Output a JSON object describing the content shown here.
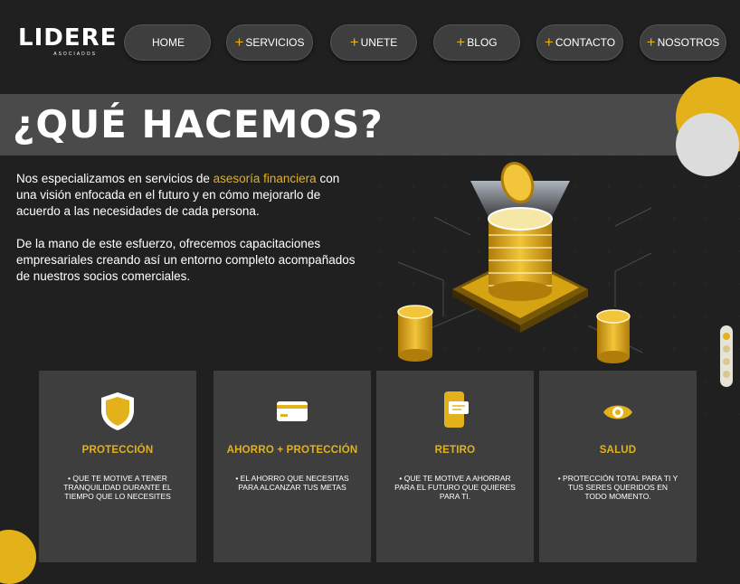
{
  "brand": {
    "name": "LIDERE",
    "tagline": "ASOCIADOS"
  },
  "nav": [
    {
      "label": "HOME",
      "plus": ""
    },
    {
      "label": "SERVICIOS",
      "plus": "+"
    },
    {
      "label": "UNETE",
      "plus": "+"
    },
    {
      "label": "BLOG",
      "plus": "+"
    },
    {
      "label": "CONTACTO",
      "plus": "+"
    },
    {
      "label": "NOSOTROS",
      "plus": "+"
    }
  ],
  "banner": {
    "title": "¿QUÉ HACEMOS?"
  },
  "intro": {
    "p1_before": "Nos especializamos en servicios de ",
    "p1_highlight": "asesoría financiera",
    "p1_after": " con una visión enfocada en el futuro y en cómo mejorarlo de acuerdo a las necesidades de cada persona.",
    "p2": "De la mano de este esfuerzo, ofrecemos capacitaciones empresariales creando así un entorno completo acompañados de nuestros socios comerciales."
  },
  "cards": [
    {
      "title": "PROTECCIÓN",
      "desc": "• QUE TE MOTIVE A TENER TRANQUILIDAD DURANTE EL TIEMPO QUE LO NECESITES",
      "icon": "shield-icon"
    },
    {
      "title": "AHORRO + PROTECCIÓN",
      "desc": "• EL AHORRO QUE NECESITAS PARA ALCANZAR TUS METAS",
      "icon": "card-icon"
    },
    {
      "title": "RETIRO",
      "desc": "• QUE TE MOTIVE A AHORRAR PARA EL FUTURO QUE QUIERES PARA TI.",
      "icon": "phone-icon"
    },
    {
      "title": "SALUD",
      "desc": "• PROTECCIÓN TOTAL PARA TI Y TUS SERES QUERIDOS EN TODO MOMENTO.",
      "icon": "eye-icon"
    }
  ],
  "colors": {
    "accent": "#e3b21b",
    "background": "#202021",
    "card": "#3e3e3f",
    "banner": "#4a4a4b"
  }
}
